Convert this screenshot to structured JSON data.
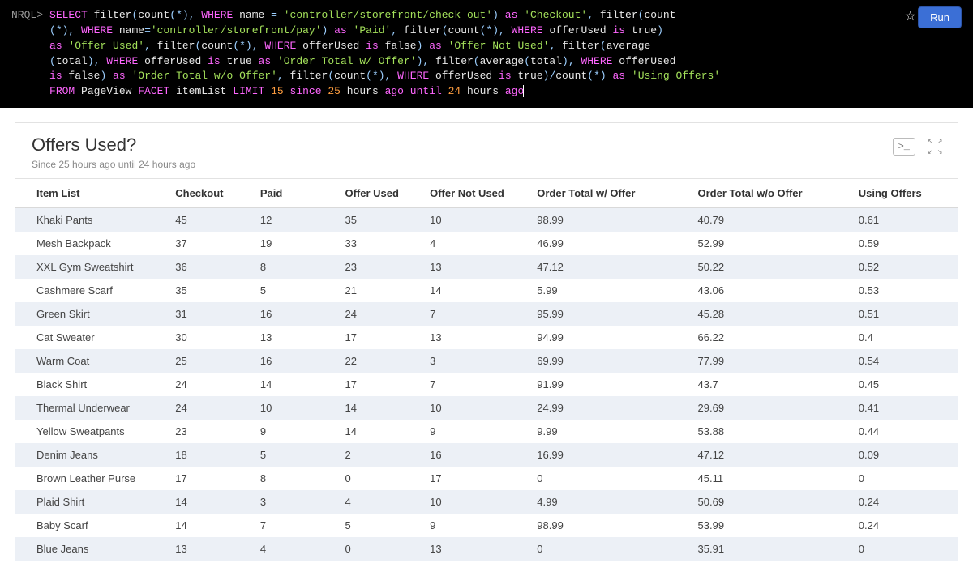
{
  "query": {
    "prompt": "NRQL>",
    "run_label": "Run",
    "tokens": [
      {
        "t": "kw",
        "v": "SELECT"
      },
      {
        "t": "plain",
        "v": " filter"
      },
      {
        "t": "fn",
        "v": "("
      },
      {
        "t": "plain",
        "v": "count"
      },
      {
        "t": "fn",
        "v": "(*), "
      },
      {
        "t": "kw",
        "v": "WHERE"
      },
      {
        "t": "plain",
        "v": " name "
      },
      {
        "t": "fn",
        "v": "= "
      },
      {
        "t": "str",
        "v": "'controller/storefront/check_out'"
      },
      {
        "t": "fn",
        "v": ") "
      },
      {
        "t": "kw",
        "v": "as"
      },
      {
        "t": "plain",
        "v": " "
      },
      {
        "t": "str",
        "v": "'Checkout'"
      },
      {
        "t": "fn",
        "v": ", "
      },
      {
        "t": "plain",
        "v": "filter"
      },
      {
        "t": "fn",
        "v": "("
      },
      {
        "t": "plain",
        "v": "count"
      },
      {
        "t": "br",
        "v": ""
      },
      {
        "t": "fn",
        "v": "(*), "
      },
      {
        "t": "kw",
        "v": "WHERE"
      },
      {
        "t": "plain",
        "v": " name"
      },
      {
        "t": "fn",
        "v": "="
      },
      {
        "t": "str",
        "v": "'controller/storefront/pay'"
      },
      {
        "t": "fn",
        "v": ") "
      },
      {
        "t": "kw",
        "v": "as"
      },
      {
        "t": "plain",
        "v": " "
      },
      {
        "t": "str",
        "v": "'Paid'"
      },
      {
        "t": "fn",
        "v": ", "
      },
      {
        "t": "plain",
        "v": "filter"
      },
      {
        "t": "fn",
        "v": "("
      },
      {
        "t": "plain",
        "v": "count"
      },
      {
        "t": "fn",
        "v": "(*), "
      },
      {
        "t": "kw",
        "v": "WHERE"
      },
      {
        "t": "plain",
        "v": " offerUsed "
      },
      {
        "t": "kw",
        "v": "is"
      },
      {
        "t": "plain",
        "v": " true"
      },
      {
        "t": "fn",
        "v": ")"
      },
      {
        "t": "br",
        "v": ""
      },
      {
        "t": "kw",
        "v": "as"
      },
      {
        "t": "plain",
        "v": " "
      },
      {
        "t": "str",
        "v": "'Offer Used'"
      },
      {
        "t": "fn",
        "v": ", "
      },
      {
        "t": "plain",
        "v": "filter"
      },
      {
        "t": "fn",
        "v": "("
      },
      {
        "t": "plain",
        "v": "count"
      },
      {
        "t": "fn",
        "v": "(*), "
      },
      {
        "t": "kw",
        "v": "WHERE"
      },
      {
        "t": "plain",
        "v": " offerUsed "
      },
      {
        "t": "kw",
        "v": "is"
      },
      {
        "t": "plain",
        "v": " false"
      },
      {
        "t": "fn",
        "v": ") "
      },
      {
        "t": "kw",
        "v": "as"
      },
      {
        "t": "plain",
        "v": " "
      },
      {
        "t": "str",
        "v": "'Offer Not Used'"
      },
      {
        "t": "fn",
        "v": ", "
      },
      {
        "t": "plain",
        "v": "filter"
      },
      {
        "t": "fn",
        "v": "("
      },
      {
        "t": "plain",
        "v": "average"
      },
      {
        "t": "br",
        "v": ""
      },
      {
        "t": "fn",
        "v": "("
      },
      {
        "t": "plain",
        "v": "total"
      },
      {
        "t": "fn",
        "v": "), "
      },
      {
        "t": "kw",
        "v": "WHERE"
      },
      {
        "t": "plain",
        "v": " offerUsed "
      },
      {
        "t": "kw",
        "v": "is"
      },
      {
        "t": "plain",
        "v": " true "
      },
      {
        "t": "kw",
        "v": "as"
      },
      {
        "t": "plain",
        "v": " "
      },
      {
        "t": "str",
        "v": "'Order Total w/ Offer'"
      },
      {
        "t": "fn",
        "v": "), "
      },
      {
        "t": "plain",
        "v": "filter"
      },
      {
        "t": "fn",
        "v": "("
      },
      {
        "t": "plain",
        "v": "average"
      },
      {
        "t": "fn",
        "v": "("
      },
      {
        "t": "plain",
        "v": "total"
      },
      {
        "t": "fn",
        "v": "), "
      },
      {
        "t": "kw",
        "v": "WHERE"
      },
      {
        "t": "plain",
        "v": " offerUsed"
      },
      {
        "t": "br",
        "v": ""
      },
      {
        "t": "kw",
        "v": "is"
      },
      {
        "t": "plain",
        "v": " false"
      },
      {
        "t": "fn",
        "v": ") "
      },
      {
        "t": "kw",
        "v": "as"
      },
      {
        "t": "plain",
        "v": " "
      },
      {
        "t": "str",
        "v": "'Order Total w/o Offer'"
      },
      {
        "t": "fn",
        "v": ", "
      },
      {
        "t": "plain",
        "v": "filter"
      },
      {
        "t": "fn",
        "v": "("
      },
      {
        "t": "plain",
        "v": "count"
      },
      {
        "t": "fn",
        "v": "(*), "
      },
      {
        "t": "kw",
        "v": "WHERE"
      },
      {
        "t": "plain",
        "v": " offerUsed "
      },
      {
        "t": "kw",
        "v": "is"
      },
      {
        "t": "plain",
        "v": " true"
      },
      {
        "t": "fn",
        "v": ")/"
      },
      {
        "t": "plain",
        "v": "count"
      },
      {
        "t": "fn",
        "v": "(*) "
      },
      {
        "t": "kw",
        "v": "as"
      },
      {
        "t": "plain",
        "v": " "
      },
      {
        "t": "str",
        "v": "'Using Offers'"
      },
      {
        "t": "br",
        "v": ""
      },
      {
        "t": "kw",
        "v": "FROM"
      },
      {
        "t": "plain",
        "v": " PageView "
      },
      {
        "t": "kw",
        "v": "FACET"
      },
      {
        "t": "plain",
        "v": " itemList "
      },
      {
        "t": "kw",
        "v": "LIMIT"
      },
      {
        "t": "plain",
        "v": " "
      },
      {
        "t": "num",
        "v": "15"
      },
      {
        "t": "plain",
        "v": " "
      },
      {
        "t": "kw",
        "v": "since"
      },
      {
        "t": "plain",
        "v": " "
      },
      {
        "t": "num",
        "v": "25"
      },
      {
        "t": "plain",
        "v": " hours "
      },
      {
        "t": "kw",
        "v": "ago"
      },
      {
        "t": "plain",
        "v": " "
      },
      {
        "t": "kw",
        "v": "until"
      },
      {
        "t": "plain",
        "v": " "
      },
      {
        "t": "num",
        "v": "24"
      },
      {
        "t": "plain",
        "v": " hours "
      },
      {
        "t": "kw",
        "v": "ago"
      }
    ]
  },
  "results": {
    "title": "Offers Used?",
    "subtitle": "Since 25 hours ago until 24 hours ago",
    "console_icon": ">_",
    "columns": [
      "Item List",
      "Checkout",
      "Paid",
      "Offer Used",
      "Offer Not Used",
      "Order Total w/ Offer",
      "Order Total w/o Offer",
      "Using Offers"
    ],
    "rows": [
      [
        "Khaki Pants",
        "45",
        "12",
        "35",
        "10",
        "98.99",
        "40.79",
        "0.61"
      ],
      [
        "Mesh Backpack",
        "37",
        "19",
        "33",
        "4",
        "46.99",
        "52.99",
        "0.59"
      ],
      [
        "XXL Gym Sweatshirt",
        "36",
        "8",
        "23",
        "13",
        "47.12",
        "50.22",
        "0.52"
      ],
      [
        "Cashmere Scarf",
        "35",
        "5",
        "21",
        "14",
        "5.99",
        "43.06",
        "0.53"
      ],
      [
        "Green Skirt",
        "31",
        "16",
        "24",
        "7",
        "95.99",
        "45.28",
        "0.51"
      ],
      [
        "Cat Sweater",
        "30",
        "13",
        "17",
        "13",
        "94.99",
        "66.22",
        "0.4"
      ],
      [
        "Warm Coat",
        "25",
        "16",
        "22",
        "3",
        "69.99",
        "77.99",
        "0.54"
      ],
      [
        "Black Shirt",
        "24",
        "14",
        "17",
        "7",
        "91.99",
        "43.7",
        "0.45"
      ],
      [
        "Thermal Underwear",
        "24",
        "10",
        "14",
        "10",
        "24.99",
        "29.69",
        "0.41"
      ],
      [
        "Yellow Sweatpants",
        "23",
        "9",
        "14",
        "9",
        "9.99",
        "53.88",
        "0.44"
      ],
      [
        "Denim Jeans",
        "18",
        "5",
        "2",
        "16",
        "16.99",
        "47.12",
        "0.09"
      ],
      [
        "Brown Leather Purse",
        "17",
        "8",
        "0",
        "17",
        "0",
        "45.11",
        "0"
      ],
      [
        "Plaid Shirt",
        "14",
        "3",
        "4",
        "10",
        "4.99",
        "50.69",
        "0.24"
      ],
      [
        "Baby Scarf",
        "14",
        "7",
        "5",
        "9",
        "98.99",
        "53.99",
        "0.24"
      ],
      [
        "Blue Jeans",
        "13",
        "4",
        "0",
        "13",
        "0",
        "35.91",
        "0"
      ]
    ]
  },
  "chart_data": {
    "type": "table",
    "title": "Offers Used?",
    "columns": [
      "Item List",
      "Checkout",
      "Paid",
      "Offer Used",
      "Offer Not Used",
      "Order Total w/ Offer",
      "Order Total w/o Offer",
      "Using Offers"
    ],
    "rows": [
      [
        "Khaki Pants",
        45,
        12,
        35,
        10,
        98.99,
        40.79,
        0.61
      ],
      [
        "Mesh Backpack",
        37,
        19,
        33,
        4,
        46.99,
        52.99,
        0.59
      ],
      [
        "XXL Gym Sweatshirt",
        36,
        8,
        23,
        13,
        47.12,
        50.22,
        0.52
      ],
      [
        "Cashmere Scarf",
        35,
        5,
        21,
        14,
        5.99,
        43.06,
        0.53
      ],
      [
        "Green Skirt",
        31,
        16,
        24,
        7,
        95.99,
        45.28,
        0.51
      ],
      [
        "Cat Sweater",
        30,
        13,
        17,
        13,
        94.99,
        66.22,
        0.4
      ],
      [
        "Warm Coat",
        25,
        16,
        22,
        3,
        69.99,
        77.99,
        0.54
      ],
      [
        "Black Shirt",
        24,
        14,
        17,
        7,
        91.99,
        43.7,
        0.45
      ],
      [
        "Thermal Underwear",
        24,
        10,
        14,
        10,
        24.99,
        29.69,
        0.41
      ],
      [
        "Yellow Sweatpants",
        23,
        9,
        14,
        9,
        9.99,
        53.88,
        0.44
      ],
      [
        "Denim Jeans",
        18,
        5,
        2,
        16,
        16.99,
        47.12,
        0.09
      ],
      [
        "Brown Leather Purse",
        17,
        8,
        0,
        17,
        0,
        45.11,
        0
      ],
      [
        "Plaid Shirt",
        14,
        3,
        4,
        10,
        4.99,
        50.69,
        0.24
      ],
      [
        "Baby Scarf",
        14,
        7,
        5,
        9,
        98.99,
        53.99,
        0.24
      ],
      [
        "Blue Jeans",
        13,
        4,
        0,
        13,
        0,
        35.91,
        0
      ]
    ]
  }
}
